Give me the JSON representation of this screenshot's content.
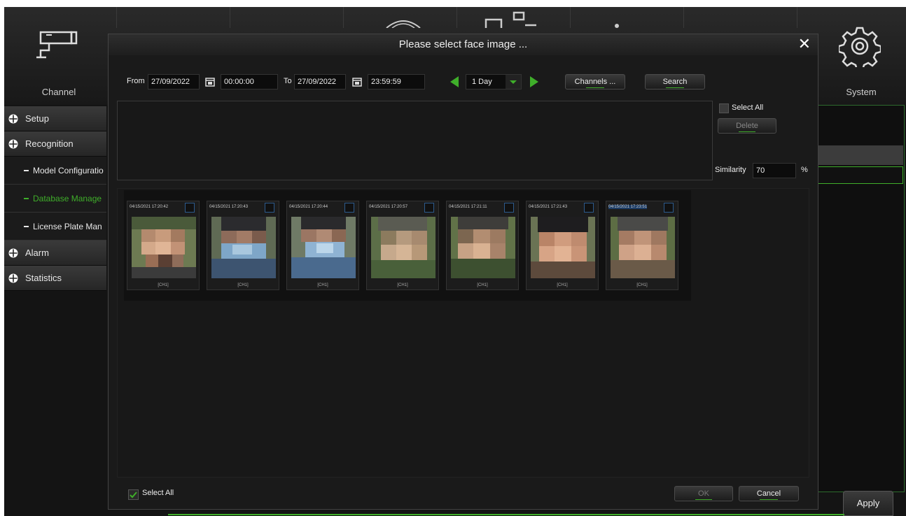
{
  "background": {
    "top_modules": {
      "channel_label": "Channel",
      "system_label": "System"
    },
    "sidebar": {
      "items": [
        {
          "label": "Setup"
        },
        {
          "label": "Recognition"
        },
        {
          "label": "Model Configuratio"
        },
        {
          "label": "Database Manage"
        },
        {
          "label": "License Plate Man"
        },
        {
          "label": "Alarm"
        },
        {
          "label": "Statistics"
        }
      ]
    },
    "apply_label": "Apply"
  },
  "modal": {
    "title": "Please select face image ...",
    "from_label": "From",
    "from_date": "27/09/2022",
    "from_time": "00:00:00",
    "to_label": "To",
    "to_date": "27/09/2022",
    "to_time": "23:59:59",
    "period": "1 Day",
    "channels_label": "Channels ...",
    "search_label": "Search",
    "select_all_label": "Select All",
    "delete_label": "Delete",
    "similarity_label": "Similarity",
    "similarity_value": "70",
    "similarity_unit": "%",
    "faces": [
      {
        "timestamp": "04/15/2021 17:20:42",
        "channel": "[CH1]",
        "selected": false
      },
      {
        "timestamp": "04/15/2021 17:20:43",
        "channel": "[CH1]",
        "selected": false
      },
      {
        "timestamp": "04/15/2021 17:20:44",
        "channel": "[CH1]",
        "selected": false
      },
      {
        "timestamp": "04/15/2021 17:20:57",
        "channel": "[CH1]",
        "selected": false
      },
      {
        "timestamp": "04/15/2021 17:21:11",
        "channel": "[CH1]",
        "selected": false
      },
      {
        "timestamp": "04/15/2021 17:21:43",
        "channel": "[CH1]",
        "selected": false
      },
      {
        "timestamp": "04/15/2021 17:23:51",
        "channel": "[CH1]",
        "selected": true
      }
    ],
    "bottom_select_all_label": "Select All",
    "ok_label": "OK",
    "cancel_label": "Cancel"
  },
  "colors": {
    "accent": "#3fae2a",
    "panel": "#1a1a1a",
    "selection": "#1d3d66"
  }
}
